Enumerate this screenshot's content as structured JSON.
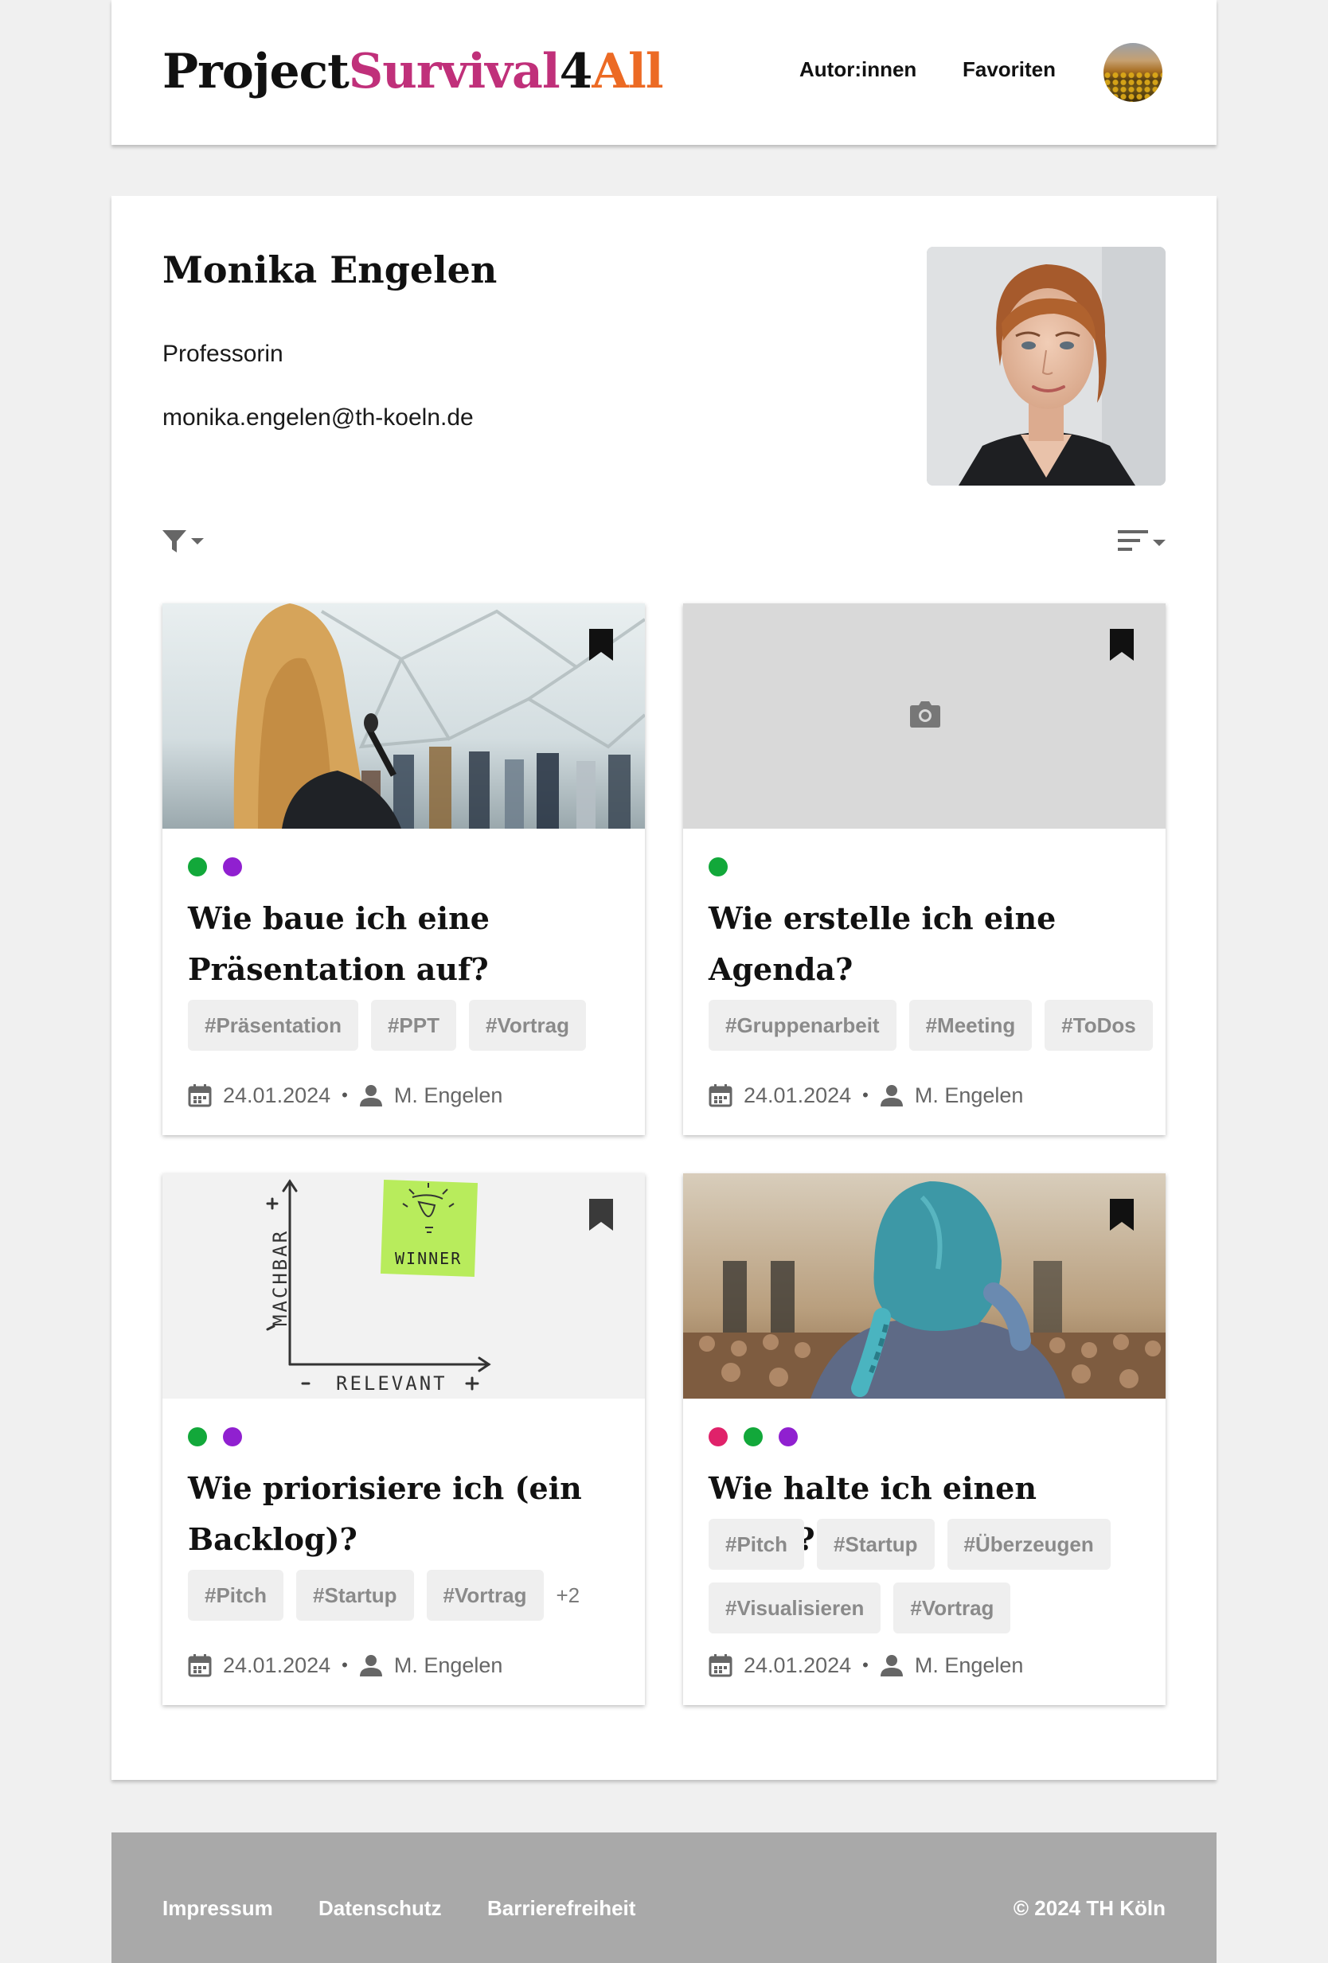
{
  "header": {
    "logo": {
      "part1": "Project",
      "part2": "Survival",
      "part3": "4",
      "part4": "All"
    },
    "nav": [
      "Autor:innen",
      "Favoriten"
    ]
  },
  "profile": {
    "name": "Monika Engelen",
    "role": "Professorin",
    "email": "monika.engelen@th-koeln.de"
  },
  "colors": {
    "green": "#12a83a",
    "purple": "#9020d0",
    "pink": "#e0226a",
    "logo_pink": "#c0307a",
    "logo_orange": "#ec6a24"
  },
  "cards": [
    {
      "title": "Wie baue ich eine Präsentation auf?",
      "image": "presentation-speaker-photo",
      "dots": [
        "green",
        "purple"
      ],
      "tags": [
        "#Präsentation",
        "#PPT",
        "#Vortrag"
      ],
      "more": "",
      "date": "24.01.2024",
      "author": "M. Engelen"
    },
    {
      "title": "Wie erstelle ich eine Agenda?",
      "image": "camera-placeholder",
      "dots": [
        "green"
      ],
      "tags": [
        "#Gruppenarbeit",
        "#Meeting",
        "#ToDos"
      ],
      "more": "",
      "date": "24.01.2024",
      "author": "M. Engelen"
    },
    {
      "title": "Wie priorisiere ich (ein Backlog)?",
      "image": "priority-matrix-sketch",
      "dots": [
        "green",
        "purple"
      ],
      "tags": [
        "#Pitch",
        "#Startup",
        "#Vortrag"
      ],
      "more": "+2",
      "date": "24.01.2024",
      "author": "M. Engelen",
      "sketch": {
        "y_label": "MACHBAR",
        "x_label": "RELEVANT",
        "note": "WINNER",
        "plus": "+",
        "minus": "-"
      }
    },
    {
      "title": "Wie halte ich einen Pitch?",
      "image": "audience-blue-hair-photo",
      "dots": [
        "pink",
        "green",
        "purple"
      ],
      "tags": [
        "#Pitch",
        "#Startup",
        "#Überzeugen",
        "#Visualisieren",
        "#Vortrag"
      ],
      "more": "",
      "date": "24.01.2024",
      "author": "M. Engelen"
    }
  ],
  "footer": {
    "links": [
      "Impressum",
      "Datenschutz",
      "Barrierefreiheit"
    ],
    "copyright": "© 2024 TH Köln"
  }
}
